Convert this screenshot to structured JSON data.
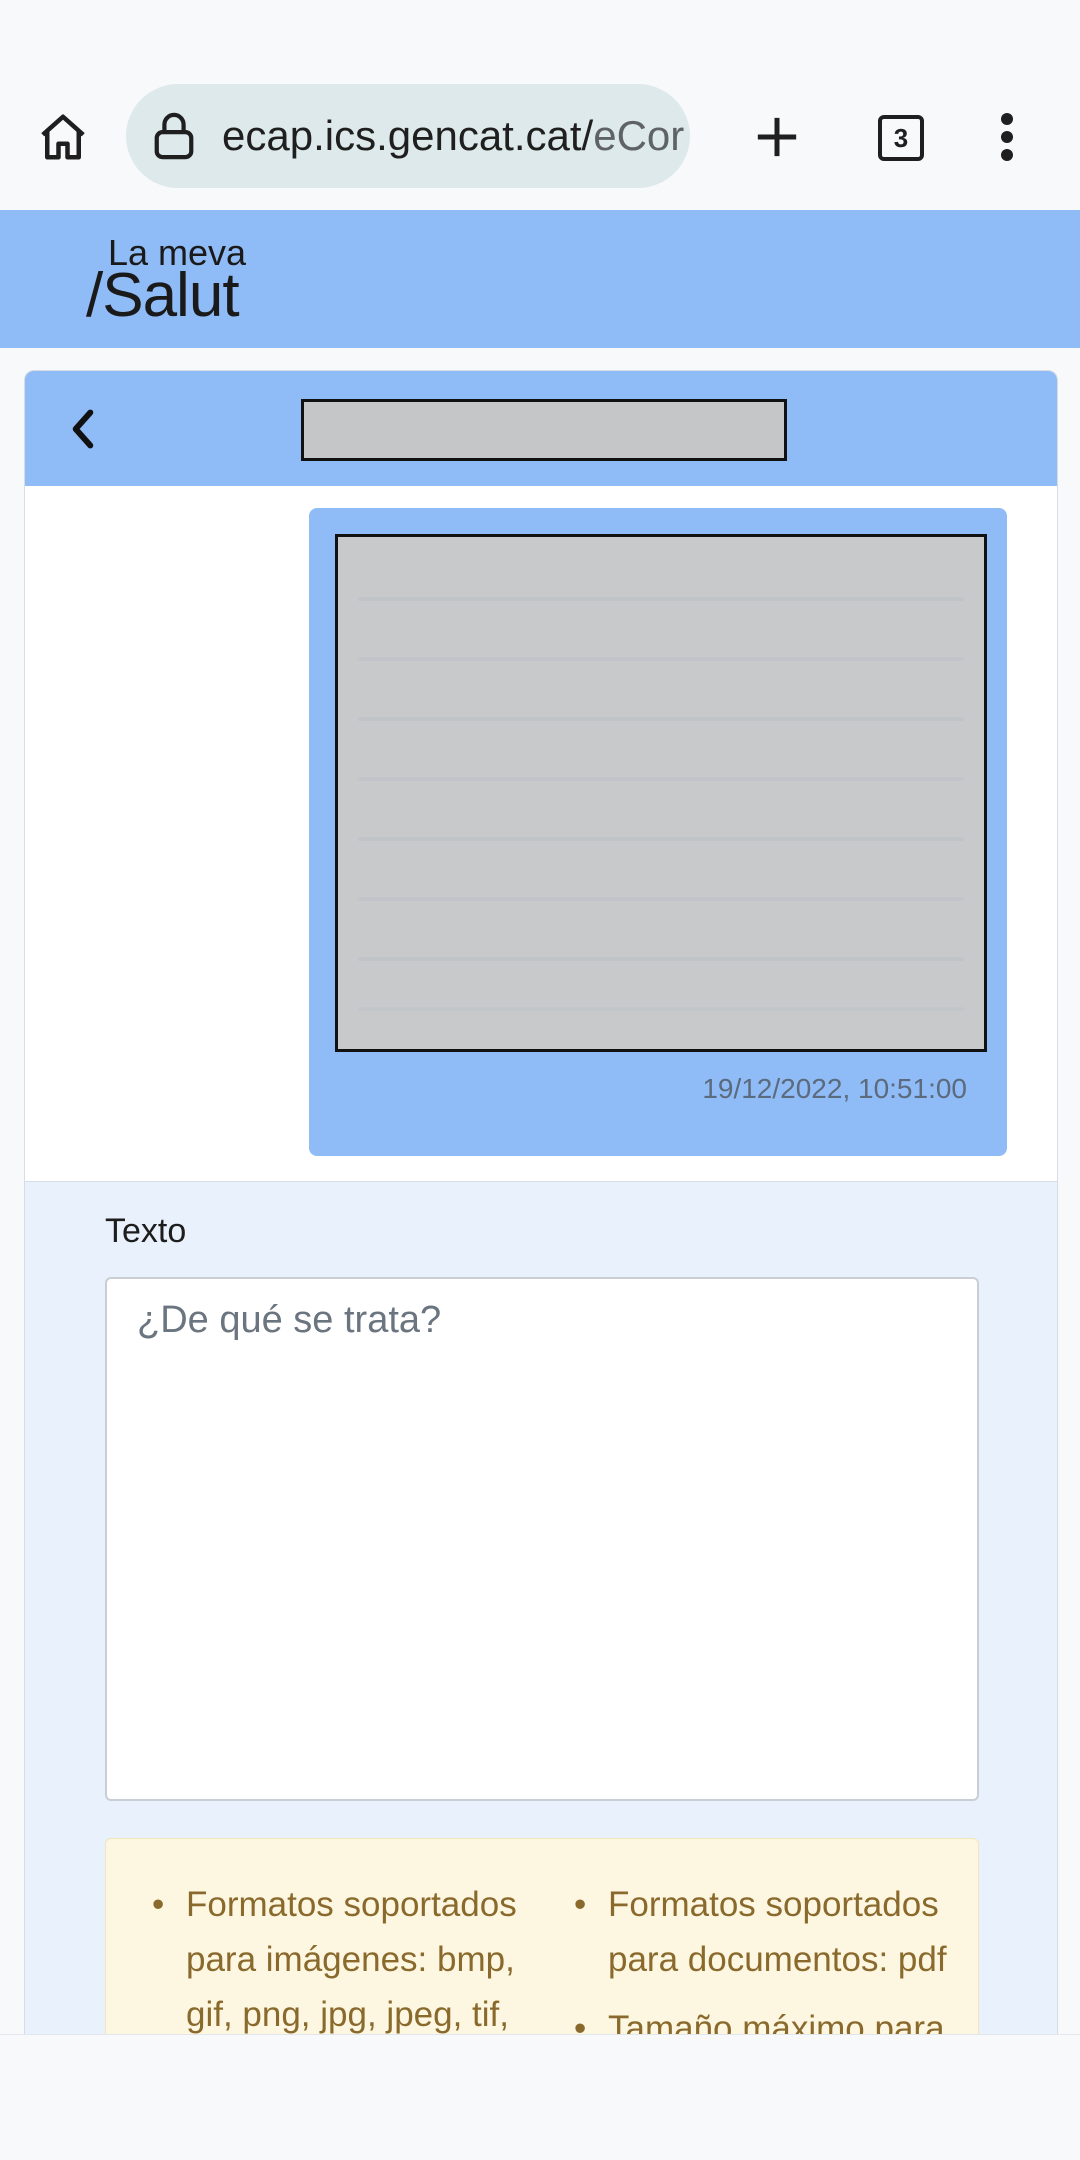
{
  "browser": {
    "url_main": "ecap.ics.gencat.cat/",
    "url_rest": "eCor",
    "tab_count": "3"
  },
  "site": {
    "logo_small": "La meva",
    "logo_big": "/Salut"
  },
  "conversation": {
    "message": {
      "timestamp": "19/12/2022, 10:51:00"
    }
  },
  "compose": {
    "label": "Texto",
    "placeholder": "¿De qué se trata?",
    "info_left": [
      "Formatos soportados para imágenes: bmp, gif, png, jpg, jpeg, tif,"
    ],
    "info_right": [
      "Formatos soportados para documentos: pdf",
      "Tamaño máximo para"
    ]
  },
  "colors": {
    "header_blue": "#8fbbf6",
    "compose_bg": "#e9f1fc",
    "info_bg": "#fdf6e1",
    "info_text": "#8a6a2c"
  }
}
